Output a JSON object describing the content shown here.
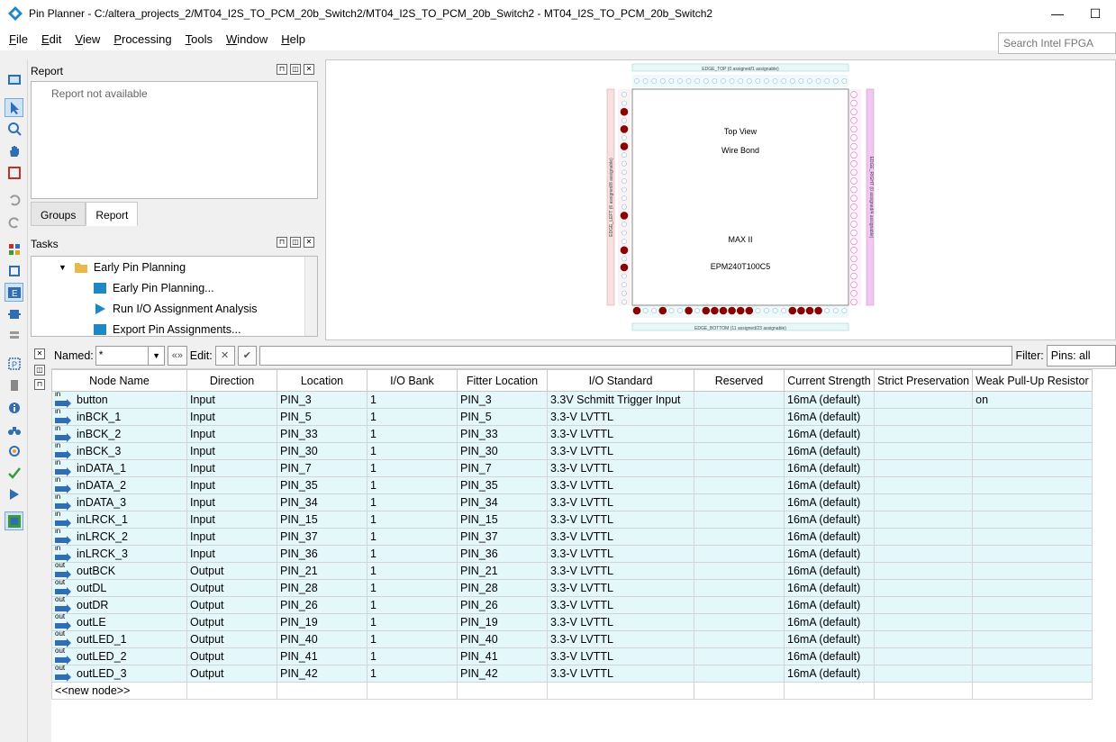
{
  "window": {
    "title": "Pin Planner - C:/altera_projects_2/MT04_I2S_TO_PCM_20b_Switch2/MT04_I2S_TO_PCM_20b_Switch2 - MT04_I2S_TO_PCM_20b_Switch2",
    "minimize": "—",
    "maximize": "☐"
  },
  "menu": [
    {
      "key": "F",
      "rest": "ile"
    },
    {
      "key": "E",
      "rest": "dit"
    },
    {
      "key": "V",
      "rest": "iew"
    },
    {
      "key": "P",
      "rest": "rocessing"
    },
    {
      "key": "T",
      "rest": "ools"
    },
    {
      "key": "W",
      "rest": "indow"
    },
    {
      "key": "H",
      "rest": "elp"
    }
  ],
  "search": {
    "placeholder": "Search Intel FPGA"
  },
  "report": {
    "title": "Report",
    "message": "Report not available"
  },
  "tabs": [
    "Groups",
    "Report"
  ],
  "tasks": {
    "title": "Tasks",
    "items": [
      "Early Pin Planning",
      "Early Pin Planning...",
      "Run I/O Assignment Analysis",
      "Export Pin Assignments..."
    ]
  },
  "chip": {
    "top_view": "Top View",
    "wire_bond": "Wire Bond",
    "family": "MAX II",
    "device": "EPM240T100C5",
    "top_bank": "EDGE_TOP (0 assigned/1 assignable)",
    "bottom_bank": "EDGE_BOTTOM (11 assigned/23 assignable)",
    "left_bank": "EDGE_LEFT (6 assigned/8 assignable)",
    "right_bank": "EDGE_RIGHT (0 assigned/4 assignable)"
  },
  "named_bar": {
    "named_label": "Named:",
    "named_value": "*",
    "edit_label": "Edit:",
    "filter_label": "Filter:",
    "filter_value": "Pins: all"
  },
  "columns": [
    "Node Name",
    "Direction",
    "Location",
    "I/O Bank",
    "Fitter Location",
    "I/O Standard",
    "Reserved",
    "Current Strength",
    "Strict Preservation",
    "Weak Pull-Up Resistor"
  ],
  "rows": [
    {
      "dir_tag": "in",
      "name": "button",
      "direction": "Input",
      "location": "PIN_3",
      "bank": "1",
      "fitter": "PIN_3",
      "standard": "3.3V Schmitt Trigger Input",
      "reserved": "",
      "strength": "16mA (default)",
      "strict": "",
      "pullup": "on"
    },
    {
      "dir_tag": "in",
      "name": "inBCK_1",
      "direction": "Input",
      "location": "PIN_5",
      "bank": "1",
      "fitter": "PIN_5",
      "standard": "3.3-V LVTTL",
      "reserved": "",
      "strength": "16mA (default)",
      "strict": "",
      "pullup": ""
    },
    {
      "dir_tag": "in",
      "name": "inBCK_2",
      "direction": "Input",
      "location": "PIN_33",
      "bank": "1",
      "fitter": "PIN_33",
      "standard": "3.3-V LVTTL",
      "reserved": "",
      "strength": "16mA (default)",
      "strict": "",
      "pullup": ""
    },
    {
      "dir_tag": "in",
      "name": "inBCK_3",
      "direction": "Input",
      "location": "PIN_30",
      "bank": "1",
      "fitter": "PIN_30",
      "standard": "3.3-V LVTTL",
      "reserved": "",
      "strength": "16mA (default)",
      "strict": "",
      "pullup": ""
    },
    {
      "dir_tag": "in",
      "name": "inDATA_1",
      "direction": "Input",
      "location": "PIN_7",
      "bank": "1",
      "fitter": "PIN_7",
      "standard": "3.3-V LVTTL",
      "reserved": "",
      "strength": "16mA (default)",
      "strict": "",
      "pullup": ""
    },
    {
      "dir_tag": "in",
      "name": "inDATA_2",
      "direction": "Input",
      "location": "PIN_35",
      "bank": "1",
      "fitter": "PIN_35",
      "standard": "3.3-V LVTTL",
      "reserved": "",
      "strength": "16mA (default)",
      "strict": "",
      "pullup": ""
    },
    {
      "dir_tag": "in",
      "name": "inDATA_3",
      "direction": "Input",
      "location": "PIN_34",
      "bank": "1",
      "fitter": "PIN_34",
      "standard": "3.3-V LVTTL",
      "reserved": "",
      "strength": "16mA (default)",
      "strict": "",
      "pullup": ""
    },
    {
      "dir_tag": "in",
      "name": "inLRCK_1",
      "direction": "Input",
      "location": "PIN_15",
      "bank": "1",
      "fitter": "PIN_15",
      "standard": "3.3-V LVTTL",
      "reserved": "",
      "strength": "16mA (default)",
      "strict": "",
      "pullup": ""
    },
    {
      "dir_tag": "in",
      "name": "inLRCK_2",
      "direction": "Input",
      "location": "PIN_37",
      "bank": "1",
      "fitter": "PIN_37",
      "standard": "3.3-V LVTTL",
      "reserved": "",
      "strength": "16mA (default)",
      "strict": "",
      "pullup": ""
    },
    {
      "dir_tag": "in",
      "name": "inLRCK_3",
      "direction": "Input",
      "location": "PIN_36",
      "bank": "1",
      "fitter": "PIN_36",
      "standard": "3.3-V LVTTL",
      "reserved": "",
      "strength": "16mA (default)",
      "strict": "",
      "pullup": ""
    },
    {
      "dir_tag": "out",
      "name": "outBCK",
      "direction": "Output",
      "location": "PIN_21",
      "bank": "1",
      "fitter": "PIN_21",
      "standard": "3.3-V LVTTL",
      "reserved": "",
      "strength": "16mA (default)",
      "strict": "",
      "pullup": ""
    },
    {
      "dir_tag": "out",
      "name": "outDL",
      "direction": "Output",
      "location": "PIN_28",
      "bank": "1",
      "fitter": "PIN_28",
      "standard": "3.3-V LVTTL",
      "reserved": "",
      "strength": "16mA (default)",
      "strict": "",
      "pullup": ""
    },
    {
      "dir_tag": "out",
      "name": "outDR",
      "direction": "Output",
      "location": "PIN_26",
      "bank": "1",
      "fitter": "PIN_26",
      "standard": "3.3-V LVTTL",
      "reserved": "",
      "strength": "16mA (default)",
      "strict": "",
      "pullup": ""
    },
    {
      "dir_tag": "out",
      "name": "outLE",
      "direction": "Output",
      "location": "PIN_19",
      "bank": "1",
      "fitter": "PIN_19",
      "standard": "3.3-V LVTTL",
      "reserved": "",
      "strength": "16mA (default)",
      "strict": "",
      "pullup": ""
    },
    {
      "dir_tag": "out",
      "name": "outLED_1",
      "direction": "Output",
      "location": "PIN_40",
      "bank": "1",
      "fitter": "PIN_40",
      "standard": "3.3-V LVTTL",
      "reserved": "",
      "strength": "16mA (default)",
      "strict": "",
      "pullup": ""
    },
    {
      "dir_tag": "out",
      "name": "outLED_2",
      "direction": "Output",
      "location": "PIN_41",
      "bank": "1",
      "fitter": "PIN_41",
      "standard": "3.3-V LVTTL",
      "reserved": "",
      "strength": "16mA (default)",
      "strict": "",
      "pullup": ""
    },
    {
      "dir_tag": "out",
      "name": "outLED_3",
      "direction": "Output",
      "location": "PIN_42",
      "bank": "1",
      "fitter": "PIN_42",
      "standard": "3.3-V LVTTL",
      "reserved": "",
      "strength": "16mA (default)",
      "strict": "",
      "pullup": ""
    }
  ],
  "new_node_label": "<<new node>>",
  "colors": {
    "row_bg": "#e4f7fb",
    "pin_assigned": "#8b0000",
    "pin_io": "#ffffff",
    "accent": "#2f6db5"
  }
}
